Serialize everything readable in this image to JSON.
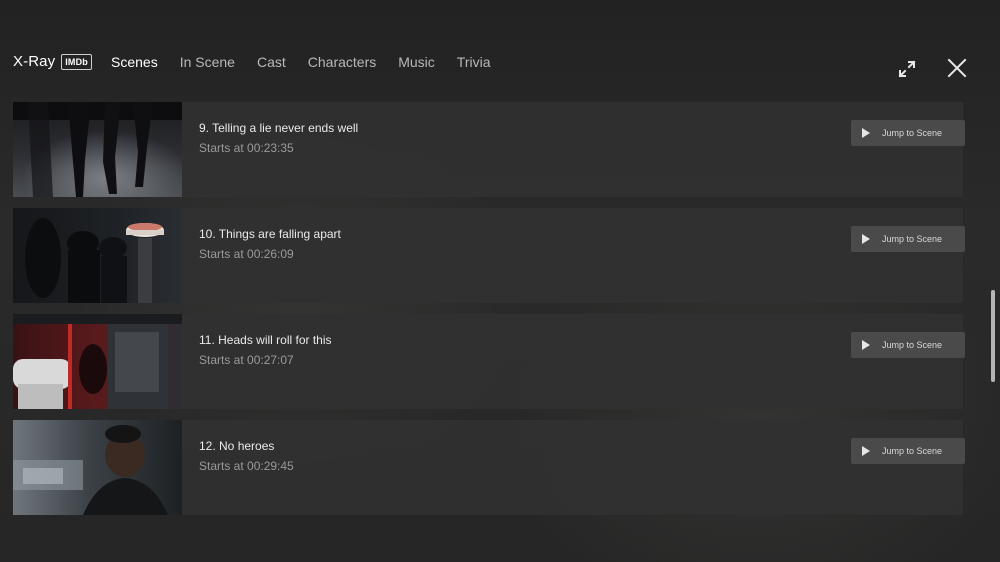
{
  "header": {
    "title": "X-Ray",
    "badge": "IMDb",
    "tabs": [
      {
        "label": "Scenes",
        "active": true
      },
      {
        "label": "In Scene",
        "active": false
      },
      {
        "label": "Cast",
        "active": false
      },
      {
        "label": "Characters",
        "active": false
      },
      {
        "label": "Music",
        "active": false
      },
      {
        "label": "Trivia",
        "active": false
      }
    ],
    "icons": {
      "expand": "expand-icon",
      "close": "close-icon"
    }
  },
  "scenes": [
    {
      "title": "9. Telling a lie never ends well",
      "start": "Starts at 00:23:35",
      "button": "Jump to Scene"
    },
    {
      "title": "10. Things are falling apart",
      "start": "Starts at 00:26:09",
      "button": "Jump to Scene"
    },
    {
      "title": "11. Heads will roll for this",
      "start": "Starts at 00:27:07",
      "button": "Jump to Scene"
    },
    {
      "title": "12. No heroes",
      "start": "Starts at 00:29:45",
      "button": "Jump to Scene"
    }
  ],
  "colors": {
    "background": "#1f1f1f",
    "row": "#303030",
    "button": "#4a4a4a",
    "text": "#eaeaea",
    "muted": "#9a9a9a"
  }
}
